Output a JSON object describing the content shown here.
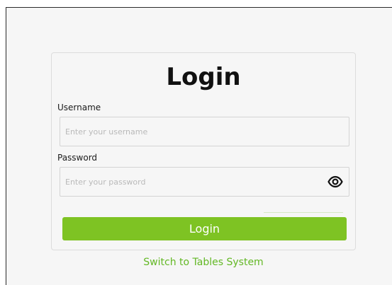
{
  "login_form": {
    "title": "Login",
    "username_label": "Username",
    "username_placeholder": "Enter your username",
    "username_value": "",
    "password_label": "Password",
    "password_placeholder": "Enter your password",
    "password_value": "",
    "toggle_visibility_icon": "eye-icon",
    "submit_label": "Login"
  },
  "footer": {
    "switch_link_label": "Switch to Tables System"
  },
  "colors": {
    "accent": "#7ec323",
    "link": "#63b825",
    "background": "#f6f6f6"
  }
}
